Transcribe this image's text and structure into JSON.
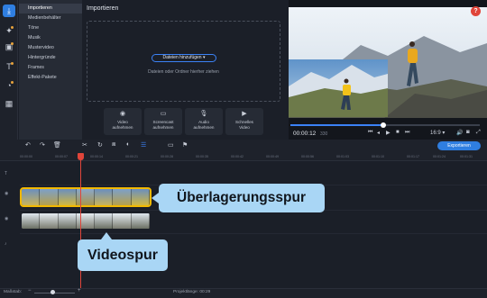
{
  "rail": {
    "icons": [
      "import-icon",
      "magic-wand-icon",
      "transitions-icon",
      "titles-icon",
      "stickers-icon",
      "more-tools-icon"
    ]
  },
  "menu": {
    "items": [
      {
        "label": "Importieren",
        "active": true
      },
      {
        "label": "Medienbehälter",
        "active": false
      },
      {
        "label": "Töne",
        "active": false
      },
      {
        "label": "Musik",
        "active": false
      },
      {
        "label": "Mustervideo",
        "active": false
      },
      {
        "label": "Hintergründe",
        "active": false
      },
      {
        "label": "Frames",
        "active": false
      },
      {
        "label": "Effekt-Pakete",
        "active": false
      }
    ]
  },
  "import": {
    "title": "Importieren",
    "add_files_label": "Dateien hinzufügen",
    "drop_hint": "Dateien oder Ordner hierher ziehen",
    "tiles": [
      {
        "label1": "Video",
        "label2": "aufnehmen",
        "icon": "webcam-icon"
      },
      {
        "label1": "Screencast",
        "label2": "aufnehmen",
        "icon": "screen-icon"
      },
      {
        "label1": "Audio",
        "label2": "aufnehmen",
        "icon": "microphone-icon"
      },
      {
        "label1": "Schnelles",
        "label2": "Video",
        "icon": "quick-video-icon"
      }
    ]
  },
  "preview": {
    "help_label": "?",
    "time_current": "00:00:12",
    "time_fraction": "330",
    "progress": 0.49,
    "aspect_ratio": "16:9 ▾",
    "controls": [
      "prev-icon",
      "play-icon",
      "stop-icon",
      "next-icon",
      "volume-icon"
    ]
  },
  "toolbar": {
    "undo": "↶",
    "redo": "↷",
    "delete": "🗑",
    "cut": "✂",
    "rotate": "↻",
    "crop": "⧈",
    "color": "◐",
    "filter": "☰",
    "clip": "▭",
    "flag": "⚑",
    "export_label": "Exportieren"
  },
  "ruler": {
    "ticks": [
      "00:00:00",
      "00:00:07",
      "00:00:14",
      "00:00:21",
      "00:00:28",
      "00:00:35",
      "00:00:42",
      "00:00:49",
      "00:00:56",
      "00:01:03",
      "00:01:10",
      "00:01:17",
      "00:01:24",
      "00:01:31"
    ]
  },
  "callouts": {
    "overlay": "Überlagerungsspur",
    "video": "Videospur"
  },
  "status": {
    "scale_label": "Maßstab:",
    "project_length": "Projektlänge:   00:29"
  },
  "colors": {
    "accent": "#2f7ee0",
    "overlay_outline": "#f2b800",
    "playhead": "#e0453a",
    "callout": "#a9d6f5"
  }
}
